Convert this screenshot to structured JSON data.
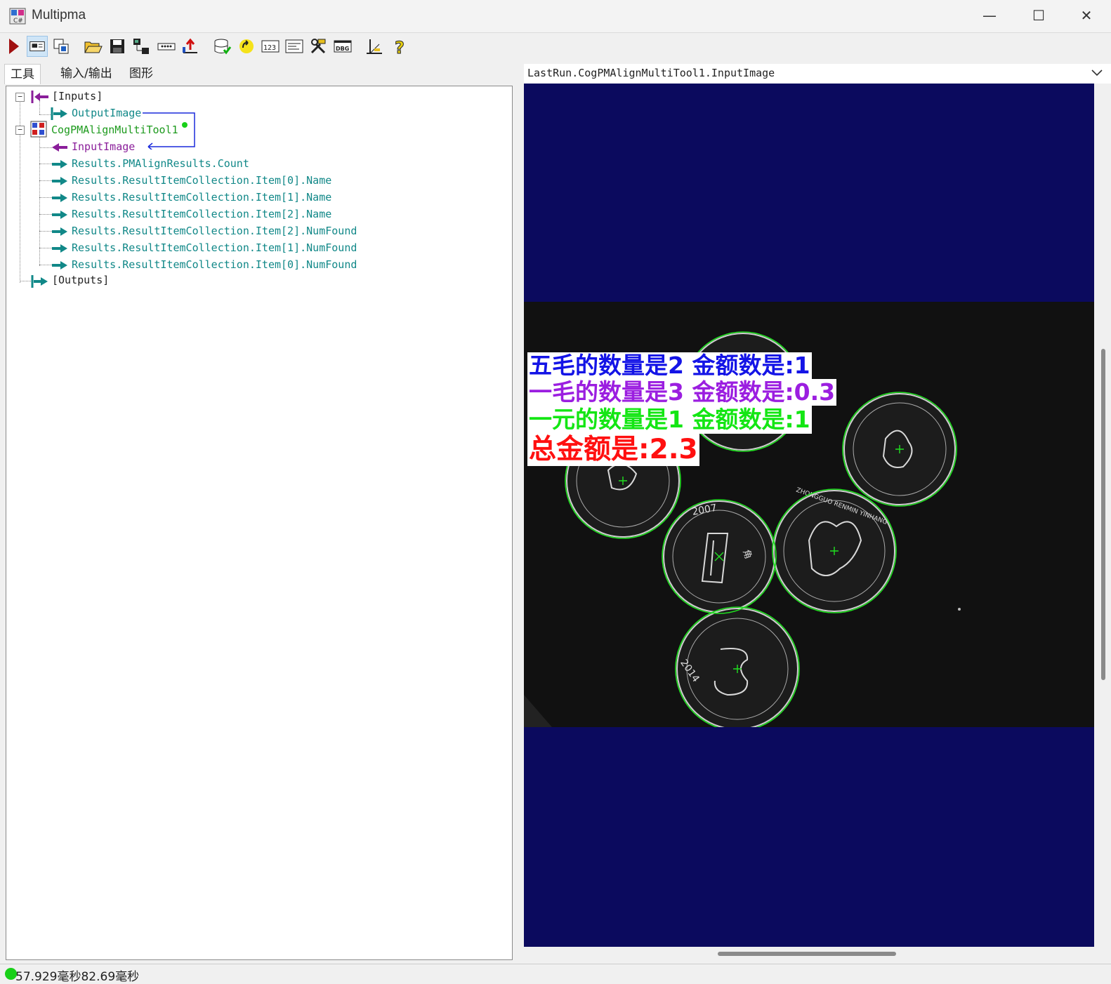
{
  "window": {
    "title": "Multipma",
    "minimize": "—",
    "maximize": "☐",
    "close": "✕"
  },
  "tabs": [
    "工具",
    "输入/输出",
    "图形"
  ],
  "tree": {
    "inputs_label": "[Inputs]",
    "output_image": "OutputImage",
    "tool_name": "CogPMAlignMultiTool1",
    "input_image": "InputImage",
    "results": [
      "Results.PMAlignResults.Count",
      "Results.ResultItemCollection.Item[0].Name",
      "Results.ResultItemCollection.Item[1].Name",
      "Results.ResultItemCollection.Item[2].Name",
      "Results.ResultItemCollection.Item[2].NumFound",
      "Results.ResultItemCollection.Item[1].NumFound",
      "Results.ResultItemCollection.Item[0].NumFound"
    ],
    "outputs_label": "[Outputs]"
  },
  "viewer": {
    "selector_value": "LastRun.CogPMAlignMultiTool1.InputImage",
    "overlay": {
      "line1": "五毛的数量是2 金额数是:1",
      "line2": "一毛的数量是3 金额数是:0.3",
      "line3": "一元的数量是1 金额数是:1",
      "line4": "总金额是:2.3"
    },
    "coins": {
      "half_yuan_year": "2007",
      "half_yuan_denomination": "角",
      "one_yuan_text": "ZHONGGUO RENMIN YINHANG",
      "small_coin_year": "2014"
    }
  },
  "status": {
    "text": "57.929毫秒82.69毫秒",
    "dot_color": "#19d019"
  },
  "colors": {
    "viewer_background": "#0b0a5e",
    "overlay_line1": "#1414e6",
    "overlay_line2": "#9b1ee0",
    "overlay_line3": "#14e614",
    "overlay_line4": "#ff1010",
    "tree_teal": "#118888",
    "tree_purple": "#8a1e9a"
  }
}
